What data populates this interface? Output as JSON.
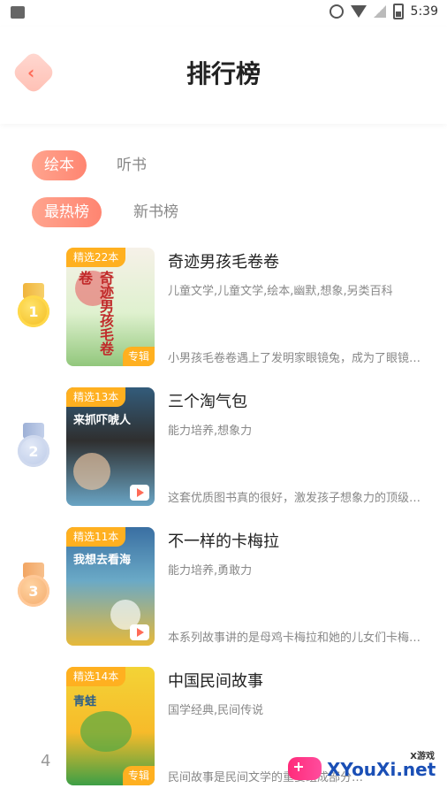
{
  "status_bar": {
    "time": "5:39"
  },
  "header": {
    "title": "排行榜"
  },
  "tabs_primary": [
    {
      "label": "绘本",
      "active": true
    },
    {
      "label": "听书",
      "active": false
    }
  ],
  "tabs_secondary": [
    {
      "label": "最热榜",
      "active": true
    },
    {
      "label": "新书榜",
      "active": false
    }
  ],
  "list": [
    {
      "rank": "1",
      "badge": "精选22本",
      "tag": "专辑",
      "title": "奇迹男孩毛卷卷",
      "tags": "儿童文学,儿童文学,绘本,幽默,想象,另类百科",
      "desc": "小男孩毛卷卷遇上了发明家眼镜兔，成为了眼镜…",
      "cover_text": "奇迹男孩毛卷卷"
    },
    {
      "rank": "2",
      "badge": "精选13本",
      "title": "三个淘气包",
      "tags": "能力培养,想象力",
      "desc": "这套优质图书真的很好，激发孩子想象力的顶级…",
      "cover_text": "来抓吓唬人"
    },
    {
      "rank": "3",
      "badge": "精选11本",
      "title": "不一样的卡梅拉",
      "tags": "能力培养,勇敢力",
      "desc": "本系列故事讲的是母鸡卡梅拉和她的儿女们卡梅…",
      "cover_text": "我想去看海"
    },
    {
      "rank": "4",
      "badge": "精选14本",
      "tag": "专辑",
      "title": "中国民间故事",
      "tags": "国学经典,民间传说",
      "desc": "民间故事是民间文学的重要组成部分…",
      "cover_text": "青蛙"
    }
  ],
  "watermark": {
    "small": "X游戏",
    "big": "XYouXi.net"
  },
  "icons": {
    "back": "back-arrow-icon",
    "alarm": "alarm-icon",
    "wifi": "wifi-icon",
    "signal": "signal-icon",
    "battery": "battery-icon"
  }
}
